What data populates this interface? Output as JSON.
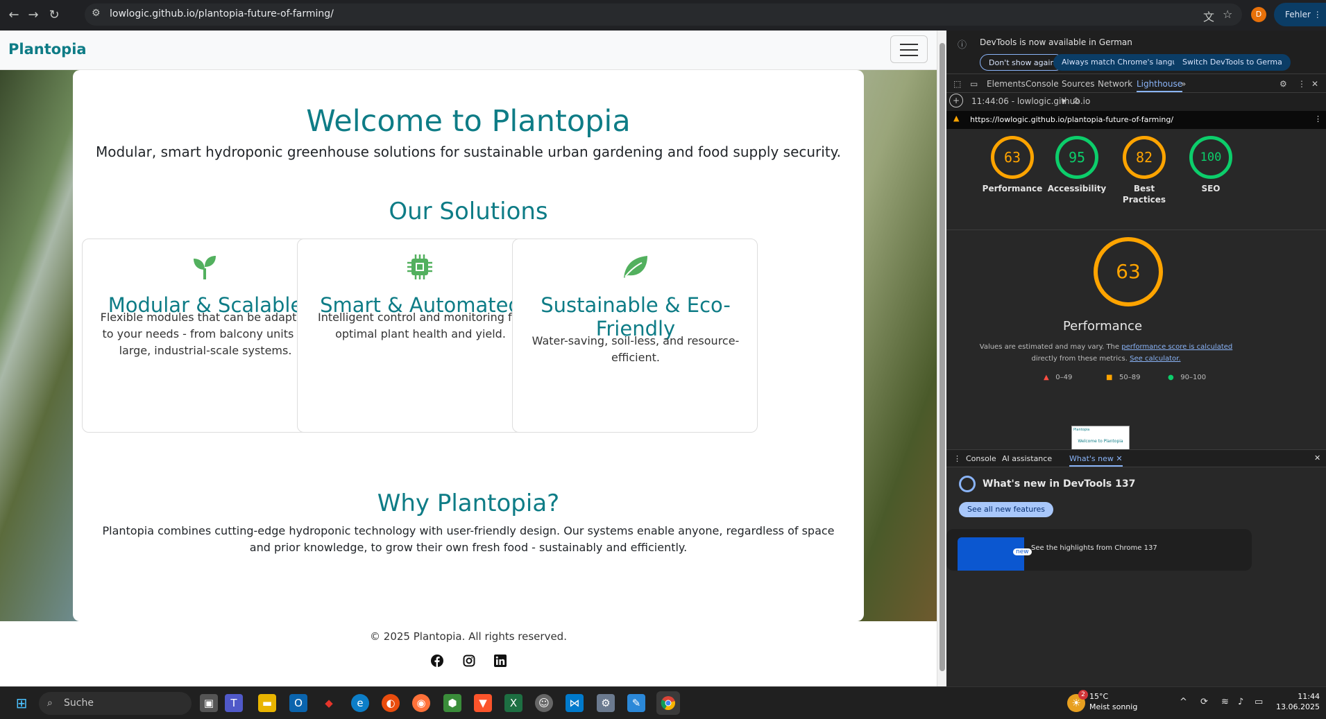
{
  "browser": {
    "url": "lowlogic.github.io/plantopia-future-of-farming/",
    "avatar_letter": "D",
    "error_button": "Fehler"
  },
  "site": {
    "brand": "Plantopia",
    "hero_title": "Welcome to Plantopia",
    "hero_subtitle": "Modular, smart hydroponic greenhouse solutions for sustainable urban gardening and food supply security.",
    "solutions_title": "Our Solutions",
    "cards": [
      {
        "icon": "sprout-icon",
        "title": "Modular & Scalable",
        "text": "Flexible modules that can be adapted to your needs - from balcony units to large, industrial-scale systems."
      },
      {
        "icon": "cpu-icon",
        "title": "Smart & Automated",
        "text": "Intelligent control and monitoring for optimal plant health and yield."
      },
      {
        "icon": "leaf-icon",
        "title": "Sustainable & Eco-Friendly",
        "text": "Water-saving, soil-less, and resource-efficient."
      }
    ],
    "why_title": "Why Plantopia?",
    "why_text": "Plantopia combines cutting-edge hydroponic technology with user-friendly design. Our systems enable anyone, regardless of space and prior knowledge, to grow their own fresh food - sustainably and efficiently.",
    "footer_copyright": "© 2025 Plantopia. All rights reserved.",
    "social": [
      "facebook-icon",
      "instagram-icon",
      "linkedin-icon"
    ]
  },
  "devtools": {
    "info_message": "DevTools is now available in German",
    "info_buttons": [
      "Don't show again",
      "Always match Chrome's language",
      "Switch DevTools to Germa"
    ],
    "tabs": [
      "Elements",
      "Console",
      "Sources",
      "Network",
      "Lighthouse"
    ],
    "active_tab": "Lighthouse",
    "report_time": "11:44:06 - lowlogic.github.io",
    "report_url": "https://lowlogic.github.io/plantopia-future-of-farming/",
    "scores": [
      {
        "value": "63",
        "label": "Performance",
        "color": "#ffa400"
      },
      {
        "value": "95",
        "label": "Accessibility",
        "color": "#0cce6b"
      },
      {
        "value": "82",
        "label": "Best Practices",
        "color": "#ffa400"
      },
      {
        "value": "100",
        "label": "SEO",
        "color": "#0cce6b"
      }
    ],
    "perf_score": "63",
    "perf_title": "Performance",
    "perf_note_1": "Values are estimated and may vary. The",
    "perf_note_link1": "performance score is calculated",
    "perf_note_2": "directly from these metrics.",
    "perf_note_link2": "See calculator.",
    "legend": [
      "0–49",
      "50–89",
      "90–100"
    ],
    "preview_brand": "Plantopia",
    "preview_title": "Welcome to Plantopia",
    "drawer_tabs": [
      "Console",
      "AI assistance",
      "What's new"
    ],
    "whats_new_title": "What's new in DevTools 137",
    "see_all_button": "See all new features",
    "new_badge": "new",
    "highlights": "See the highlights from Chrome 137"
  },
  "taskbar": {
    "search_placeholder": "Suche",
    "temperature": "15°C",
    "weather": "Meist sonnig",
    "weather_badge": "2",
    "time": "11:44",
    "date": "13.06.2025"
  }
}
